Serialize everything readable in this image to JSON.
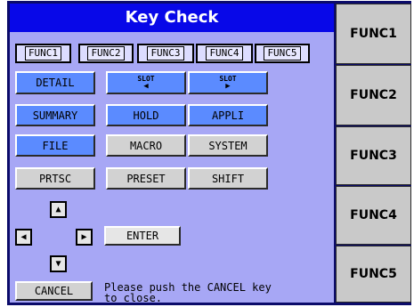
{
  "dialog": {
    "title": "Key Check",
    "func_row": [
      "FUNC1",
      "FUNC2",
      "FUNC3",
      "FUNC4",
      "FUNC5"
    ],
    "keys": {
      "detail": "DETAIL",
      "slot_left": {
        "label": "SLOT",
        "arrow": "◀"
      },
      "slot_right": {
        "label": "SLOT",
        "arrow": "▶"
      },
      "summary": "SUMMARY",
      "hold": "HOLD",
      "appli": "APPLI",
      "file": "FILE",
      "macro": "MACRO",
      "system": "SYSTEM",
      "prtsc": "PRTSC",
      "preset": "PRESET",
      "shift": "SHIFT",
      "up": "▲",
      "left": "◀",
      "right": "▶",
      "down": "▼",
      "enter": "ENTER",
      "cancel": "CANCEL"
    },
    "message_line1": "Please push the CANCEL key",
    "message_line2": "to close."
  },
  "right_panel": [
    "FUNC1",
    "FUNC2",
    "FUNC3",
    "FUNC4",
    "FUNC5"
  ],
  "colors": {
    "title_bg": "#0808e8",
    "dialog_bg": "#a7a7f5",
    "highlight_key": "#5b8bff",
    "normal_key": "#d2d2d2",
    "frame": "#0b0b6a"
  }
}
